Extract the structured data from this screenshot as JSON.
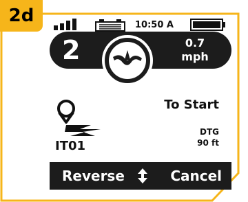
{
  "step_label": "2d",
  "status": {
    "signal_icon": "signal-bars-icon",
    "battery12_icon": "battery-12v-icon",
    "time": "10:50 A",
    "battery_icon": "battery-icon",
    "battery_level": 1.0
  },
  "speed_pill": {
    "gear": "2",
    "mode_icon": "autopilot-route-icon",
    "speed_value": "0.7",
    "speed_unit": "mph"
  },
  "route": {
    "icon": "route-waypoint-icon",
    "name": "IT01",
    "destination": "To Start",
    "dtg_label": "DTG",
    "dtg_value": "90 ft"
  },
  "softkeys": {
    "left": "Reverse",
    "middle_icon": "up-down-arrow-icon",
    "right": "Cancel"
  },
  "colors": {
    "accent": "#f6b51a",
    "panel": "#1c1c1c",
    "text": "#111111",
    "background": "#ffffff"
  }
}
